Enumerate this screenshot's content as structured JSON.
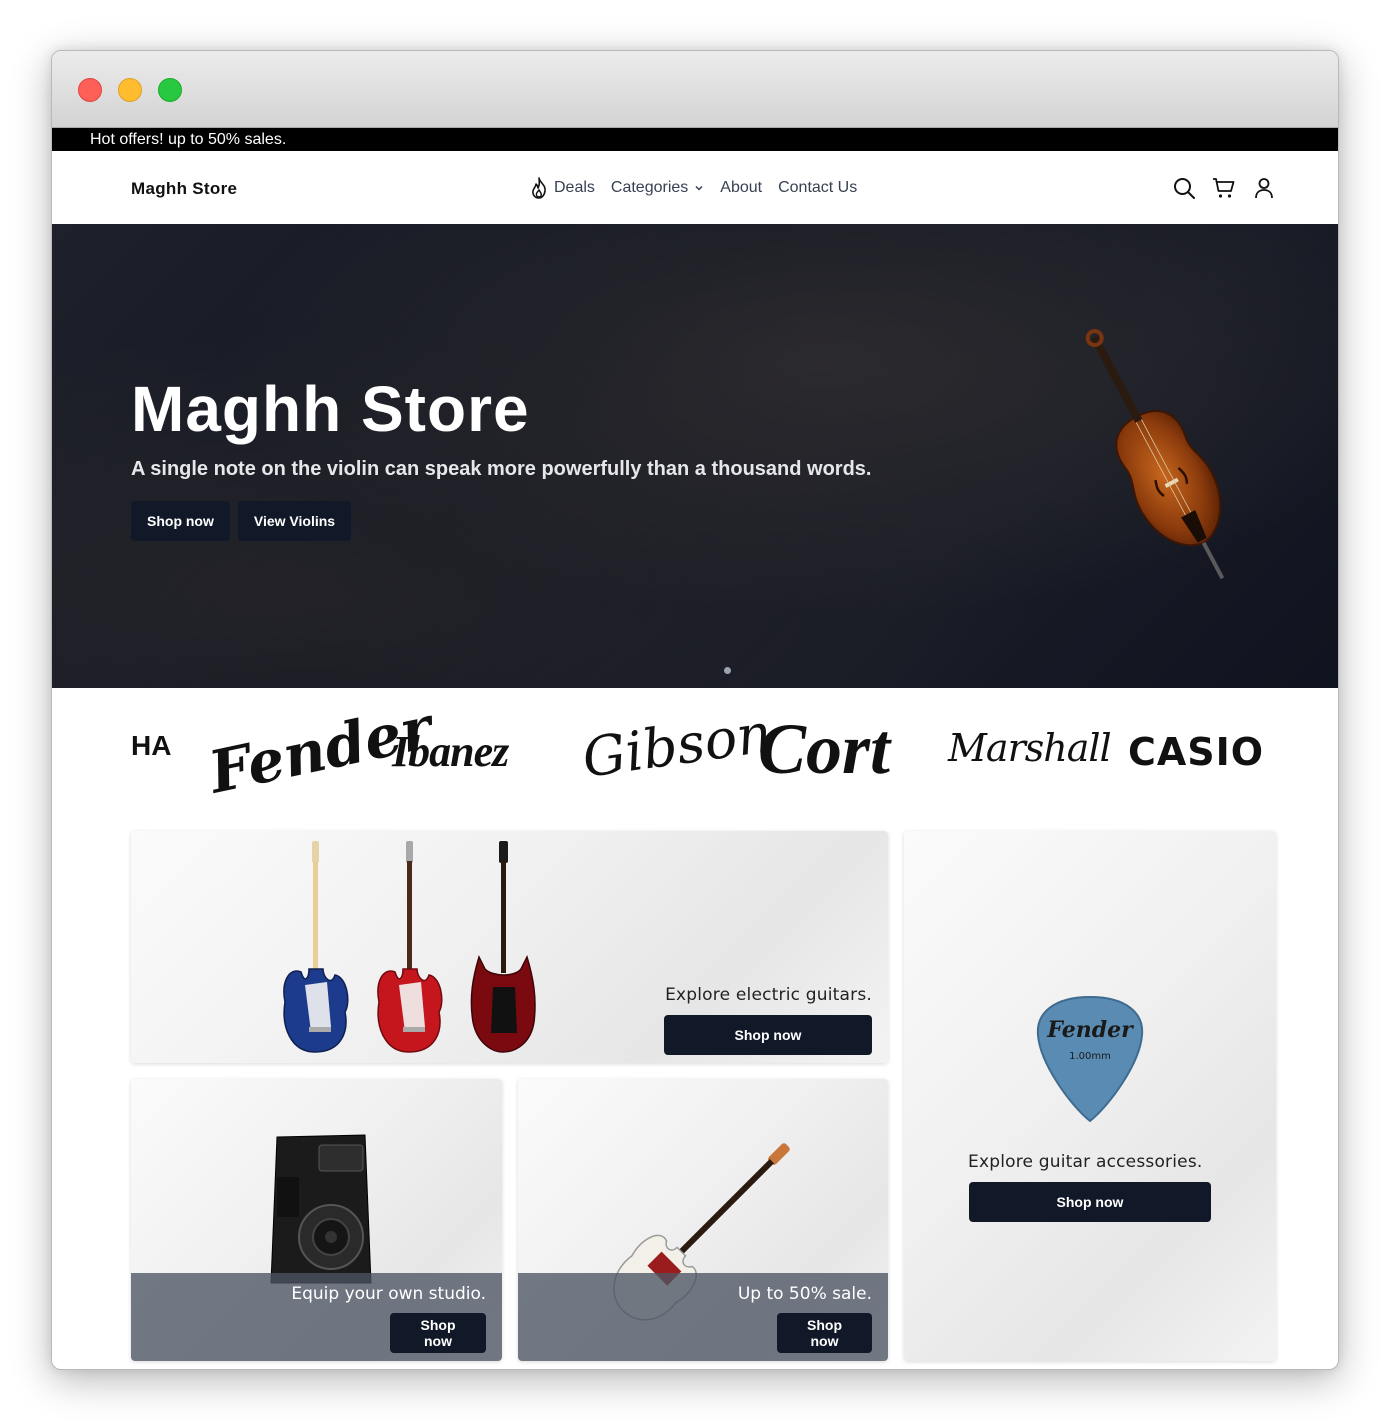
{
  "promo": {
    "text": "Hot offers! up to 50% sales."
  },
  "nav": {
    "brand": "Maghh Store",
    "links": [
      {
        "label": "Deals",
        "icon": "fire-icon"
      },
      {
        "label": "Categories",
        "icon": "chevron-down-icon"
      },
      {
        "label": "About"
      },
      {
        "label": "Contact Us"
      }
    ],
    "icons": [
      "search-icon",
      "cart-icon",
      "user-icon"
    ]
  },
  "hero": {
    "title": "Maghh Store",
    "subtitle": "A single note on the violin can speak more powerfully than a thousand words.",
    "primary_button": "Shop now",
    "secondary_button": "View Violins",
    "slide_count": 1
  },
  "brands": [
    "HA",
    "Fender",
    "Ibanez",
    "Gibson",
    "Cort",
    "Marshall",
    "CASIO"
  ],
  "cards": {
    "electric": {
      "text": "Explore electric guitars.",
      "button": "Shop now"
    },
    "accessories": {
      "text": "Explore guitar accessories.",
      "button": "Shop now",
      "pick_brand": "Fender",
      "pick_size": "1.00mm"
    },
    "studio": {
      "text": "Equip your own studio.",
      "button": "Shop now"
    },
    "sale": {
      "text": "Up to 50% sale.",
      "button": "Shop now"
    }
  },
  "colors": {
    "button_bg": "#111827",
    "promo_bg": "#000000",
    "overlay": "#4b5563"
  }
}
